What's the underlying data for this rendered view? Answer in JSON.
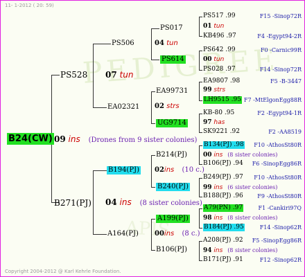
{
  "header": {
    "date": "11-  1-2012 ( 20: 59)"
  },
  "footer": {
    "copyright": "Copyright 2004-2012 @ Karl Kehrle Foundation."
  },
  "root": {
    "id": "B24(CW)",
    "year": "09",
    "breeder": "ins",
    "note": "(Drones from 9 sister colonies)"
  },
  "gen1": [
    {
      "id": "PS528"
    },
    {
      "id": "B271(PJ)",
      "year": "04",
      "breeder": "ins",
      "note": "(8 sister colonies)"
    }
  ],
  "gen2": [
    {
      "id": "PS506",
      "year": "07",
      "breeder": "tun"
    },
    {
      "id": "EA02321"
    },
    {
      "id": "B194(PJ)"
    },
    {
      "id": "A164(PJ)",
      "year": "00",
      "breeder": "ins",
      "note": "(8 c.)"
    }
  ],
  "gen3": [
    {
      "id": "PS017",
      "year": "04",
      "breeder": "tun"
    },
    {
      "id": "PS614"
    },
    {
      "id": "EA99731",
      "year": "02",
      "breeder": "strs"
    },
    {
      "id": "UG9714"
    },
    {
      "id": "B214(PJ)",
      "year": "02",
      "breeder": "ins",
      "note": "(10 c.)"
    },
    {
      "id": "B240(PJ)"
    },
    {
      "id": "A199(PJ)"
    },
    {
      "id": "B106(PJ)"
    }
  ],
  "gen4": [
    {
      "id": "PS517",
      "yr": ".99",
      "line": "F15 -Sinop72R"
    },
    {
      "year": "01",
      "breeder": "tun"
    },
    {
      "id": "KB496",
      "yr": ".97",
      "line": "F4 -Egypt94-2R"
    },
    {
      "id": "PS642",
      "yr": ".99",
      "line": "F0 -Carnic99R"
    },
    {
      "year": "00",
      "breeder": "tun"
    },
    {
      "id": "PS028",
      "yr": ".97",
      "line": "F14 -Sinop72R"
    },
    {
      "id": "EA9807",
      "yr": ".98",
      "line": "F5 -B-3447"
    },
    {
      "year": "99",
      "breeder": "strs"
    },
    {
      "id": "LH9515",
      "yr": ".95",
      "line": "F7 -MtElgonEgg88R"
    },
    {
      "id": "KB-80",
      "yr": ".95",
      "line": "F2 -Egypt94-1R"
    },
    {
      "year": "97",
      "breeder": "has"
    },
    {
      "id": "SK9221",
      "yr": ".92",
      "line": "F2 -AA8519"
    },
    {
      "id": "B134(PJ)",
      "yr": ".98",
      "line": "F10 -AthosSt80R"
    },
    {
      "year": "00",
      "breeder": "ins",
      "note": "(8 sister colonies)"
    },
    {
      "id": "B106(PJ)",
      "yr": ".94",
      "line": "F6 -SinopEgg86R"
    },
    {
      "id": "B249(PJ)",
      "yr": ".97",
      "line": "F10 -AthosSt80R"
    },
    {
      "year": "99",
      "breeder": "ins",
      "note": "(6 sister colonies)"
    },
    {
      "id": "B188(PJ)",
      "yr": ".96",
      "line": "F9 -AthosSt80R"
    },
    {
      "id": "A79(PN)",
      "yr": ".97",
      "line": "F1 -Cankiri97Q"
    },
    {
      "year": "98",
      "breeder": "ins",
      "note": "(8 sister colonies)"
    },
    {
      "id": "B184(PJ)",
      "yr": ".95",
      "line": "F14 -Sinop62R"
    },
    {
      "id": "A208(PJ)",
      "yr": ".92",
      "line": "F5 -SinopEgg86R"
    },
    {
      "year": "94",
      "breeder": "ins",
      "note": "(8 sister colonies)"
    },
    {
      "id": "B171(PJ)",
      "yr": ".91",
      "line": "F12 -Sinop62R"
    }
  ]
}
